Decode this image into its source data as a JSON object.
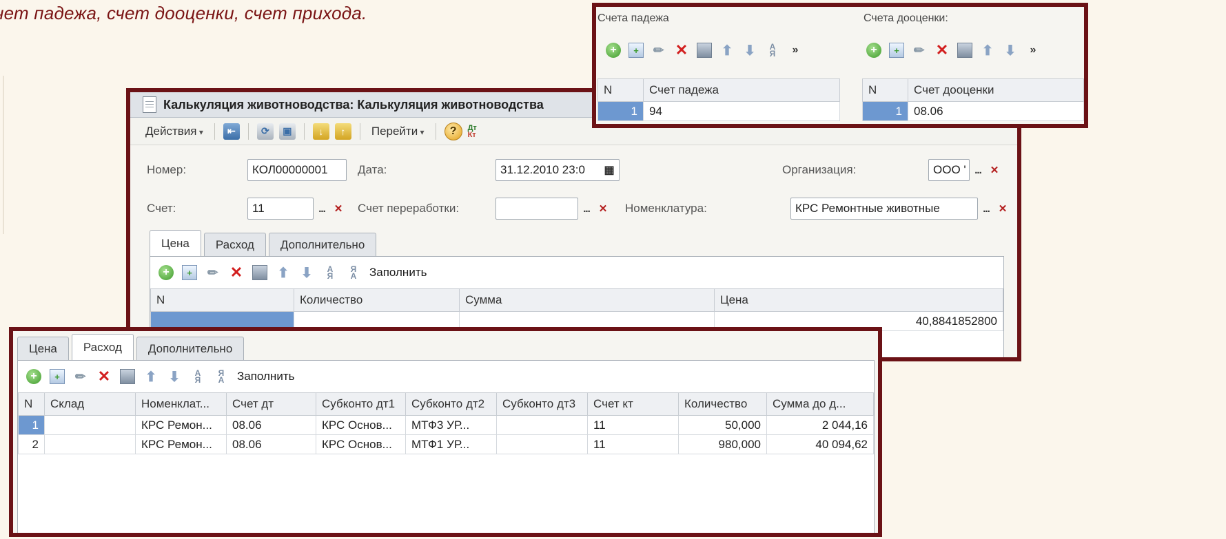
{
  "headline": "чет падежа, счет дооценки, счет прихода.",
  "main_window": {
    "title": "Калькуляция животноводства: Калькуляция животноводства",
    "actions_label": "Действия",
    "goto_label": "Перейти",
    "dtkt_top": "Дт",
    "dtkt_bottom": "Кт",
    "help_glyph": "?",
    "number_label": "Номер:",
    "number_value": "КОЛ00000001",
    "date_label": "Дата:",
    "date_value": "31.12.2010 23:0",
    "org_label": "Организация:",
    "org_value": "ООО '",
    "account_label": "Счет:",
    "account_value": "11",
    "processing_label": "Счет переработки:",
    "processing_value": "",
    "nomenclature_label": "Номенклатура:",
    "nomenclature_value": "КРС Ремонтные животные",
    "tabs": [
      "Цена",
      "Расход",
      "Дополнительно"
    ],
    "fill_label": "Заполнить",
    "columns": [
      "N",
      "Количество",
      "Сумма",
      "Цена"
    ],
    "price_value": "40,8841852800"
  },
  "top_window": {
    "loss_title": "Счета падежа",
    "revaluation_title": "Счета дооценки:",
    "loss_columns": [
      "N",
      "Счет падежа"
    ],
    "loss_rows": [
      {
        "n": "1",
        "account": "94"
      }
    ],
    "revaluation_columns": [
      "N",
      "Счет дооценки"
    ],
    "revaluation_rows": [
      {
        "n": "1",
        "account": "08.06"
      }
    ]
  },
  "bottom_window": {
    "tabs": [
      "Цена",
      "Расход",
      "Дополнительно"
    ],
    "fill_label": "Заполнить",
    "columns": [
      "N",
      "Склад",
      "Номенклат...",
      "Счет дт",
      "Субконто дт1",
      "Субконто дт2",
      "Субконто дт3",
      "Счет кт",
      "Количество",
      "Сумма до д..."
    ],
    "rows": [
      {
        "n": "1",
        "warehouse": "",
        "nomenclature": "КРС Ремон...",
        "debit": "08.06",
        "sub1": "КРС Основ...",
        "sub2": "МТФ3 УР...",
        "sub3": "",
        "credit": "11",
        "qty": "50,000",
        "sum": "2 044,16"
      },
      {
        "n": "2",
        "warehouse": "",
        "nomenclature": "КРС Ремон...",
        "debit": "08.06",
        "sub1": "КРС Основ...",
        "sub2": "МТФ1 УР...",
        "sub3": "",
        "credit": "11",
        "qty": "980,000",
        "sum": "40 094,62"
      }
    ]
  },
  "colors": {
    "frame": "#6b1216",
    "headline": "#7a1414",
    "selection": "#6d98d0"
  }
}
